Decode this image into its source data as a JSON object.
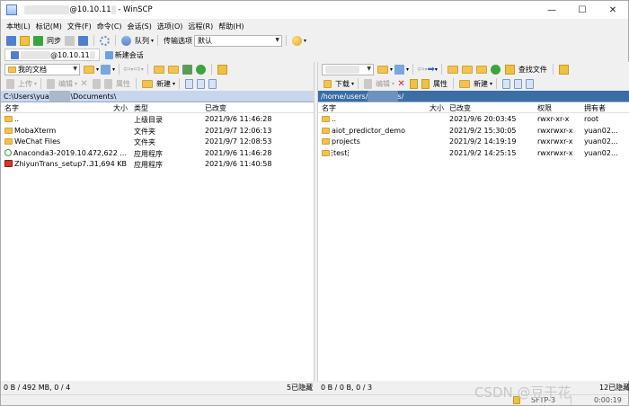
{
  "window": {
    "title_blur": "xxxxxxxxxx",
    "title_suffix": "@10.10.11",
    "title_blur2": "x",
    "title_app": " - WinSCP",
    "minimize": "—",
    "maximize": "☐",
    "close": "✕"
  },
  "menu": [
    "本地(L)",
    "标记(M)",
    "文件(F)",
    "命令(C)",
    "会话(S)",
    "选项(O)",
    "远程(R)",
    "帮助(H)"
  ],
  "toolbar": {
    "sync_label": "同步",
    "queue_label": "队列",
    "transfer_opts_label": "传输选项",
    "transfer_opts_value": "默认"
  },
  "session": {
    "tab_blur": "xxxxxxx",
    "tab_host": "@10.10.11",
    "new_session": "新建会话"
  },
  "left": {
    "location": "我的文档",
    "upload": "上传",
    "edit": "编辑",
    "properties": "属性",
    "new": "新建",
    "path_prefix": "C:\\Users\\yua",
    "path_blur": "xxxxx",
    "path_suffix": "\\Documents\\",
    "columns": [
      "名字",
      "大小",
      "类型",
      "已改变"
    ],
    "rows": [
      {
        "name": "..",
        "size": "",
        "type": "上级目录",
        "date": "2021/9/6  11:46:28",
        "icon": "up"
      },
      {
        "name": "MobaXterm",
        "size": "",
        "type": "文件夹",
        "date": "2021/9/7  12:06:13",
        "icon": "folder"
      },
      {
        "name": "WeChat Files",
        "size": "",
        "type": "文件夹",
        "date": "2021/9/7  12:08:53",
        "icon": "folder"
      },
      {
        "name": "Anaconda3-2019.10...",
        "size": "472,622 ...",
        "type": "应用程序",
        "date": "2021/9/6  11:46:28",
        "icon": "exe1"
      },
      {
        "name": "ZhiyunTrans_setup7...",
        "size": "31,694 KB",
        "type": "应用程序",
        "date": "2021/9/6  11:40:58",
        "icon": "exe2"
      }
    ],
    "status": "0 B / 492 MB,  0 / 4",
    "hidden": "5已隐藏"
  },
  "right": {
    "location_blur": "xxxxxxxx",
    "download": "下载",
    "edit": "编辑",
    "properties": "属性",
    "new": "新建",
    "find_files": "查找文件",
    "path_prefix": "/home/users/",
    "path_blur": "xxxxxxx",
    "path_suffix": "s/",
    "columns": [
      "名字",
      "大小",
      "已改变",
      "权限",
      "拥有者"
    ],
    "rows": [
      {
        "name": "..",
        "size": "",
        "date": "2021/9/6 20:03:45",
        "perm": "rwxr-xr-x",
        "owner": "root",
        "icon": "up"
      },
      {
        "name": "aiot_predictor_demo",
        "size": "",
        "date": "2021/9/2 15:30:05",
        "perm": "rwxrwxr-x",
        "owner": "yuan02...",
        "icon": "folder"
      },
      {
        "name": "projects",
        "size": "",
        "date": "2021/9/2 14:19:19",
        "perm": "rwxrwxr-x",
        "owner": "yuan02...",
        "icon": "folder"
      },
      {
        "name": "test",
        "size": "",
        "date": "2021/9/2 14:25:15",
        "perm": "rwxrwxr-x",
        "owner": "yuan02...",
        "icon": "folder"
      }
    ],
    "status": "0 B / 0 B,  0 / 3",
    "hidden": "12已隐藏",
    "protocol": "SFTP-3",
    "time": "0:00:19"
  },
  "watermark": "CSDN @豆干花"
}
